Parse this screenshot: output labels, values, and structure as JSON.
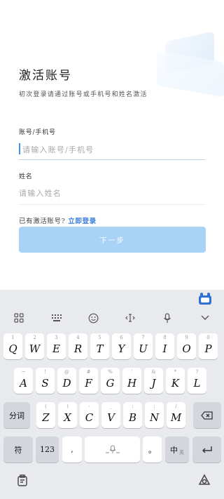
{
  "page": {
    "title": "激活账号",
    "subtitle": "初次登录请通过账号或手机号和姓名激活"
  },
  "form": {
    "account_label": "账号/手机号",
    "account_placeholder": "请输入账号/手机号",
    "name_label": "姓名",
    "name_placeholder": "请输入姓名",
    "activated_prompt": "已有激活账号?",
    "login_link": "立即登录",
    "next_button": "下一步"
  },
  "keyboard": {
    "row1": [
      {
        "hint": "1",
        "key": "Q"
      },
      {
        "hint": "2",
        "key": "W"
      },
      {
        "hint": "3",
        "key": "E"
      },
      {
        "hint": "4",
        "key": "R"
      },
      {
        "hint": "5",
        "key": "T"
      },
      {
        "hint": "6",
        "key": "Y"
      },
      {
        "hint": "7",
        "key": "U"
      },
      {
        "hint": "8",
        "key": "I"
      },
      {
        "hint": "9",
        "key": "O"
      },
      {
        "hint": "0",
        "key": "P"
      }
    ],
    "row2": [
      {
        "hint": "~",
        "key": "A"
      },
      {
        "hint": "!",
        "key": "S"
      },
      {
        "hint": "@",
        "key": "D"
      },
      {
        "hint": "#",
        "key": "F"
      },
      {
        "hint": "%",
        "key": "G"
      },
      {
        "hint": "'",
        "key": "H"
      },
      {
        "hint": "&",
        "key": "J"
      },
      {
        "hint": "*",
        "key": "K"
      },
      {
        "hint": "?",
        "key": "L"
      }
    ],
    "row3": [
      {
        "hint": "(",
        "key": "Z"
      },
      {
        "hint": ")",
        "key": "X"
      },
      {
        "hint": "-",
        "key": "C"
      },
      {
        "hint": "_",
        "key": "V"
      },
      {
        "hint": ":",
        "key": "B"
      },
      {
        "hint": ";",
        "key": "N"
      },
      {
        "hint": "/",
        "key": "M"
      }
    ],
    "segment_key": "分词",
    "symbol_key": "符",
    "numbers_key": "123",
    "comma_key": ",",
    "period_key": "。",
    "lang_key": "中",
    "lang_hint": "英",
    "toolbar_icons": [
      "grid-icon",
      "keyboard-icon",
      "emoji-icon",
      "cursor-icon",
      "microphone-icon",
      "collapse-icon"
    ]
  },
  "colors": {
    "accent": "#3a7de0",
    "button_disabled": "#a9d2f7",
    "keyboard_bg": "#e9eaee"
  }
}
